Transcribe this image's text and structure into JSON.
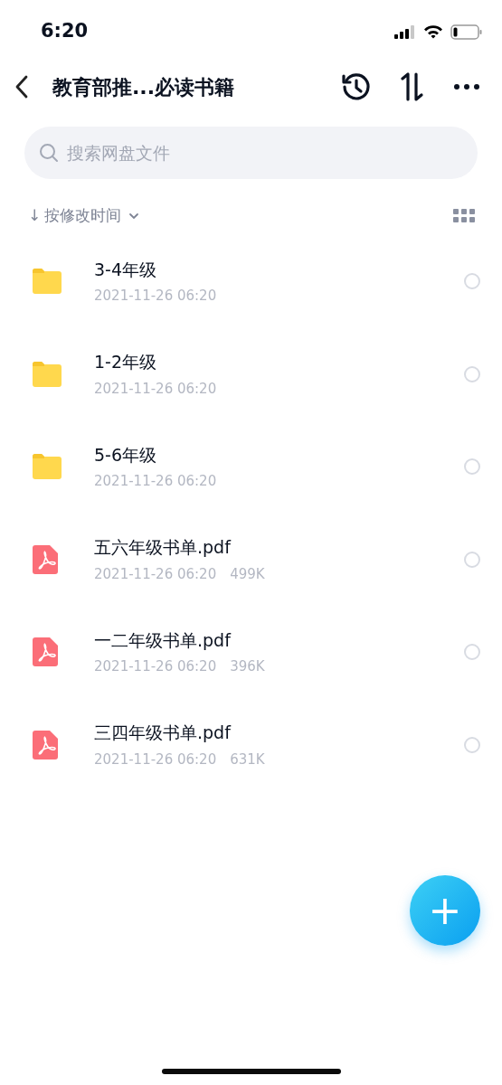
{
  "status_bar": {
    "time": "6:20"
  },
  "header": {
    "title": "教育部推...必读书籍"
  },
  "search": {
    "placeholder": "搜索网盘文件"
  },
  "sort": {
    "arrow": "↓",
    "label": "按修改时间"
  },
  "files": [
    {
      "kind": "folder",
      "name": "3-4年级",
      "date": "2021-11-26 06:20",
      "selected": false
    },
    {
      "kind": "folder",
      "name": "1-2年级",
      "date": "2021-11-26 06:20",
      "selected": false
    },
    {
      "kind": "folder",
      "name": "5-6年级",
      "date": "2021-11-26 06:20",
      "selected": false
    },
    {
      "kind": "pdf",
      "name": "五六年级书单.pdf",
      "date": "2021-11-26 06:20",
      "size": "499K",
      "selected": false
    },
    {
      "kind": "pdf",
      "name": "一二年级书单.pdf",
      "date": "2021-11-26 06:20",
      "size": "396K",
      "selected": false
    },
    {
      "kind": "pdf",
      "name": "三四年级书单.pdf",
      "date": "2021-11-26 06:20",
      "size": "631K",
      "selected": false
    }
  ],
  "fab": {
    "label": "+"
  }
}
